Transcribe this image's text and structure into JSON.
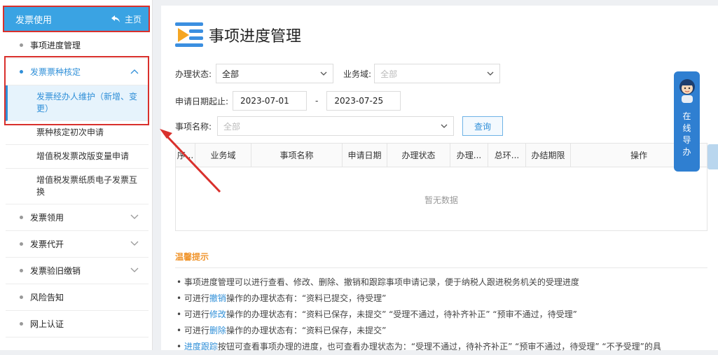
{
  "sidebar": {
    "header_title": "发票使用",
    "home_label": "主页",
    "items": [
      {
        "label": "事项进度管理"
      },
      {
        "label": "发票票种核定"
      },
      {
        "label": "发票领用"
      },
      {
        "label": "发票代开"
      },
      {
        "label": "发票验旧缴销"
      },
      {
        "label": "风险告知"
      },
      {
        "label": "网上认证"
      }
    ],
    "sub_items": [
      {
        "label": "发票经办人维护（新增、变更）"
      },
      {
        "label": "票种核定初次申请"
      },
      {
        "label": "增值税发票改版变量申请"
      },
      {
        "label": "增值税发票纸质电子发票互换"
      }
    ]
  },
  "main": {
    "title": "事项进度管理",
    "filters": {
      "status_label": "办理状态:",
      "status_value": "全部",
      "domain_label": "业务域:",
      "domain_placeholder": "全部",
      "date_label": "申请日期起止:",
      "date_from": "2023-07-01",
      "date_sep": "-",
      "date_to": "2023-07-25",
      "item_label": "事项名称:",
      "item_placeholder": "全部",
      "query_button": "查询"
    },
    "table": {
      "columns": [
        "序...",
        "业务域",
        "事项名称",
        "申请日期",
        "办理状态",
        "办理...",
        "总环...",
        "办结期限",
        "操作"
      ],
      "empty_text": "暂无数据"
    },
    "tips": {
      "title": "温馨提示",
      "lines": [
        {
          "bullet": "•",
          "prefix": "事项进度管理可以进行查看、修改、删除、撤销和跟踪事项申请记录，便于纳税人跟进税务机关的受理进度",
          "hl": "",
          "suffix": ""
        },
        {
          "bullet": "•",
          "prefix": "可进行",
          "hl": "撤销",
          "suffix": "操作的办理状态有：“资料已提交，待受理”"
        },
        {
          "bullet": "•",
          "prefix": "可进行",
          "hl": "修改",
          "suffix": "操作的办理状态有：“资料已保存，未提交”  “受理不通过，待补齐补正”  “预审不通过，待受理”"
        },
        {
          "bullet": "•",
          "prefix": "可进行",
          "hl": "删除",
          "suffix": "操作的办理状态有：“资料已保存，未提交”"
        },
        {
          "bullet": "•",
          "prefix": "",
          "hl": "进度跟踪",
          "suffix": "按钮可查看事项办理的进度，也可查看办理状态为：“受理不通过，待补齐补正”  “预审不通过，待受理”  “不予受理”的具"
        }
      ]
    }
  },
  "guide": {
    "text": "在线导办"
  },
  "icons": {
    "home": "home-back-icon",
    "chevron_up": "chevron-up-icon",
    "chevron_down": "chevron-down-icon",
    "dropdown": "dropdown-arrow-icon",
    "title": "list-play-icon",
    "guide_avatar": "assistant-avatar-icon"
  },
  "colors": {
    "accent": "#3aa3e3",
    "highlight_blue": "#2f8fd8",
    "annotation_red": "#d9302c",
    "tips_orange": "#f0962f"
  }
}
